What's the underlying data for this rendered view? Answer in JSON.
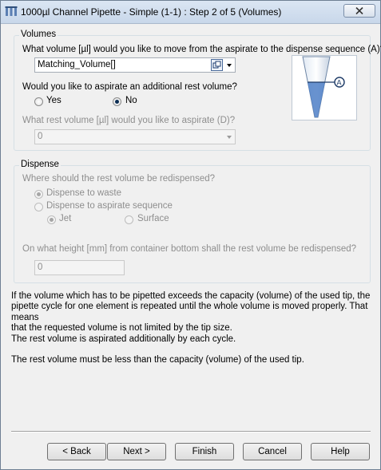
{
  "window": {
    "title": "1000µl Channel Pipette - Simple (1-1) : Step 2 of 5 (Volumes)"
  },
  "volumes_group": {
    "title": "Volumes",
    "volume_question": "What volume [µl] would you like to move from the aspirate to the dispense sequence (A)?",
    "volume_value": "Matching_Volume[]",
    "rest_question": "Would you like to aspirate an additional rest volume?",
    "yes_label": "Yes",
    "no_label": "No",
    "selected": "No",
    "rest_volume_question": "What rest volume [µl] would you like to aspirate (D)?",
    "rest_volume_value": "0",
    "diagram_marker": "A"
  },
  "dispense_group": {
    "title": "Dispense",
    "question": "Where should the rest volume be redispensed?",
    "to_waste_label": "Dispense to waste",
    "to_aspirate_label": "Dispense to aspirate sequence",
    "jet_label": "Jet",
    "surface_label": "Surface",
    "height_question": "On what height [mm] from container bottom shall the rest volume be redispensed?",
    "height_value": "0"
  },
  "info": {
    "paragraph1_line1": "If the volume which has to be pipetted exceeds the capacity (volume) of the used tip, the",
    "paragraph1_line2": "pipette cycle for one element is repeated until the whole volume is moved properly. That means",
    "paragraph1_line3": "that the requested volume is not limited by the tip size.",
    "paragraph1_line4": "The rest volume is aspirated additionally by each cycle.",
    "paragraph2": "The rest volume must be less than the capacity (volume) of the used tip."
  },
  "buttons": {
    "back": "< Back",
    "next": "Next >",
    "finish": "Finish",
    "cancel": "Cancel",
    "help": "Help"
  },
  "icons": {
    "app": "pipette-app-icon",
    "close": "close-icon",
    "variable_picker": "variable-picker-icon",
    "dropdown": "chevron-down-icon"
  }
}
